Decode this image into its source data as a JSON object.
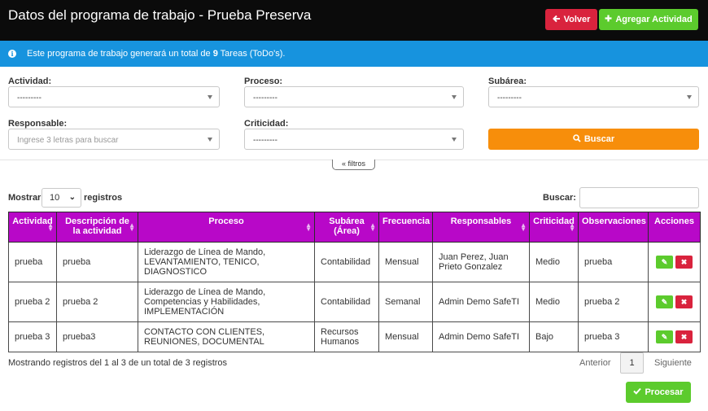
{
  "header": {
    "title": "Datos del programa de trabajo - Prueba Preserva",
    "back_label": "Volver",
    "back_icon": "arrow-left-icon",
    "add_label": "Agregar Actividad",
    "add_icon": "plus-icon"
  },
  "info": {
    "prefix": "Este programa de trabajo generará un total de ",
    "count": "9",
    "suffix": " Tareas (ToDo's)."
  },
  "filters": {
    "actividad": {
      "label": "Actividad:",
      "value": "---------"
    },
    "proceso": {
      "label": "Proceso:",
      "value": "---------"
    },
    "subarea": {
      "label": "Subárea:",
      "value": "---------"
    },
    "responsable": {
      "label": "Responsable:",
      "placeholder": "Ingrese 3 letras para buscar"
    },
    "criticidad": {
      "label": "Criticidad:",
      "value": "---------"
    },
    "search_button": "Buscar",
    "toggle_label": "filtros"
  },
  "table_controls": {
    "show_label": "Mostrar",
    "page_length": "10",
    "records_label": "registros",
    "search_label": "Buscar:"
  },
  "table": {
    "headers": [
      "Actividad",
      "Descripción de la actividad",
      "Proceso",
      "Subárea (Área)",
      "Frecuencia",
      "Responsables",
      "Criticidad",
      "Observaciones",
      "Acciones"
    ],
    "rows": [
      [
        "prueba",
        "prueba",
        "Liderazgo de Línea de Mando, LEVANTAMIENTO, TENICO, DIAGNOSTICO",
        "Contabilidad",
        "Mensual",
        "Juan Perez, Juan Prieto Gonzalez",
        "Medio",
        "prueba"
      ],
      [
        "prueba 2",
        "prueba 2",
        "Liderazgo de Línea de Mando, Competencias y Habilidades, IMPLEMENTACIÓN",
        "Contabilidad",
        "Semanal",
        "Admin Demo SafeTI",
        "Medio",
        "prueba 2"
      ],
      [
        "prueba 3",
        "prueba3",
        "CONTACTO CON CLIENTES, REUNIONES, DOCUMENTAL",
        "Recursos Humanos",
        "Mensual",
        "Admin Demo SafeTI",
        "Bajo",
        "prueba 3"
      ]
    ]
  },
  "footer": {
    "summary": "Mostrando registros del 1 al 3 de un total de 3 registros",
    "prev": "Anterior",
    "page": "1",
    "next": "Siguiente",
    "process_label": "Procesar"
  },
  "colors": {
    "header_bg": "#0b0b0b",
    "info_bg": "#1793de",
    "table_header": "#b808c8",
    "danger": "#d9233d",
    "success": "#5ccb2d",
    "warning": "#f78e0b"
  }
}
